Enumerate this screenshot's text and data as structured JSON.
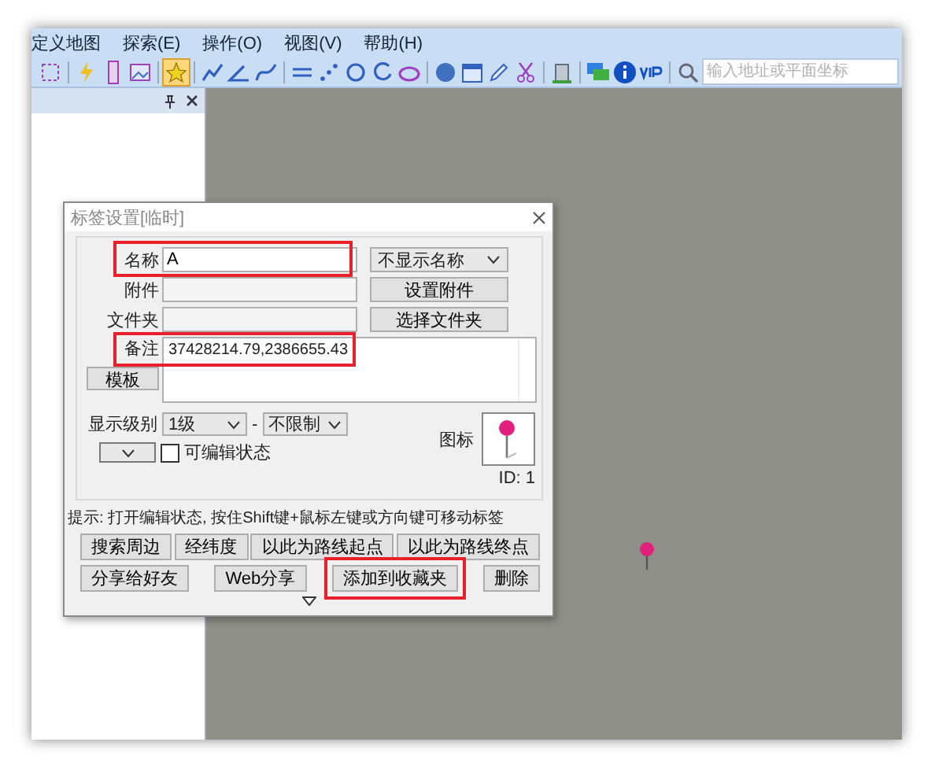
{
  "menu": [
    {
      "label": "定义地图"
    },
    {
      "label": "探索(E)"
    },
    {
      "label": "操作(O)"
    },
    {
      "label": "视图(V)"
    },
    {
      "label": "帮助(H)"
    }
  ],
  "search": {
    "placeholder": "输入地址或平面坐标"
  },
  "dialog": {
    "title": "标签设置[临时]",
    "fields": [
      {
        "label": "名称",
        "value": "A",
        "highlighted": true,
        "side": {
          "kind": "select",
          "text": "不显示名称"
        }
      },
      {
        "label": "附件",
        "highlighted": false,
        "side": {
          "kind": "button",
          "text": "设置附件"
        }
      },
      {
        "label": "文件夹",
        "highlighted": false,
        "side": {
          "kind": "button",
          "text": "选择文件夹"
        }
      }
    ],
    "note": {
      "label": "备注",
      "value": "37428214.79,2386655.43",
      "highlighted": true
    },
    "template_button": "模板",
    "level": {
      "label": "显示级别",
      "from": "1级",
      "separator": "-",
      "to": "不限制"
    },
    "editable": {
      "label": "可编辑状态",
      "checked": false
    },
    "icon_label": "图标",
    "id_text": "ID: 1",
    "hint": "提示: 打开编辑状态, 按住Shift键+鼠标左键或方向键可移动标签",
    "button_rows": [
      {
        "buttons": [
          {
            "label": "搜索周边",
            "highlighted": false
          },
          {
            "label": "经纬度",
            "highlighted": false
          },
          {
            "label": "以此为路线起点",
            "highlighted": false
          },
          {
            "label": "以此为路线终点",
            "highlighted": false
          }
        ]
      },
      {
        "buttons": [
          {
            "label": "分享给好友",
            "highlighted": false
          },
          {
            "label": "Web分享",
            "highlighted": false
          },
          {
            "label": "添加到收藏夹",
            "highlighted": true
          },
          {
            "label": "删除",
            "highlighted": false
          }
        ]
      }
    ]
  }
}
